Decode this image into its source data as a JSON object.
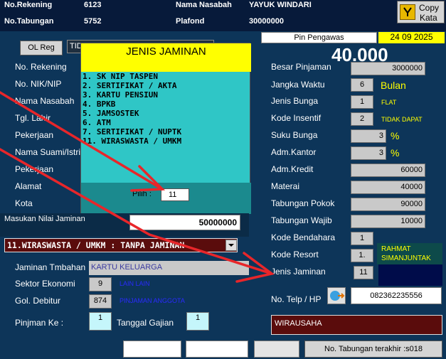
{
  "header": {
    "no_rekening_label": "No.Rekening",
    "no_rekening_value": "6123",
    "nama_nasabah_label": "Nama Nasabah",
    "nama_nasabah_value": "YAYUK WINDARI",
    "no_tabungan_label": "No.Tabungan",
    "no_tabungan_value": "5752",
    "plafond_label": "Plafond",
    "plafond_value": "30000000",
    "copy_kata_line1": "Copy",
    "copy_kata_line2": "Kata"
  },
  "pin_pengawas_label": "Pin Pengawas",
  "date": "24 09 2025",
  "big_amount": "40.000",
  "ol_reg_label": "OL Reg",
  "ol_reg_field": "TID",
  "left_labels": {
    "no_rekening": "No. Rekening",
    "no_nik": "No. NIK/NIP",
    "nama_nasabah": "Nama Nasabah",
    "tgl_lahir": "Tgl. Lahir",
    "pekerjaan": "Pekerjaan",
    "nama_suami": "Nama Suami/Istri",
    "pekerjaan2": "Pekerjaan",
    "alamat": "Alamat",
    "kota": "Kota"
  },
  "popup": {
    "title": "JENIS JAMINAN",
    "items": [
      "1. SK NIP TASPEN",
      "2. SERTIFIKAT / AKTA",
      "3. KARTU PENSIUN",
      "4. BPKB",
      "5. JAMSOSTEK",
      "6. ATM",
      "7. SERTIFIKAT / NUPTK",
      "11. WIRASWASTA / UMKM"
    ],
    "pilih_label": "Pilih :",
    "pilih_value": "11"
  },
  "masukan_label": "Masukan Nilai Jaminan",
  "masukan_value": "50000000",
  "jaminan_select": "11.WIRASWASTA / UMKM : TANPA JAMINAN",
  "jaminan_tambahan_label": "Jaminan Tmbahan",
  "jaminan_tambahan_value": "KARTU KELUARGA",
  "sektor_label": "Sektor Ekonomi",
  "sektor_code": "9",
  "sektor_text": "LAIN LAIN",
  "gol_label": "Gol. Debitur",
  "gol_code": "874",
  "gol_text": "PINJAMAN ANGGOTA",
  "pinjaman_ke_label": "Pinjman Ke :",
  "pinjaman_ke_value": "1",
  "tanggal_gajian_label": "Tanggal Gajian",
  "tanggal_gajian_value": "1",
  "right": {
    "besar_pinjaman_label": "Besar Pinjaman",
    "besar_pinjaman_value": "3000000",
    "jangka_waktu_label": "Jangka Waktu",
    "jangka_waktu_value": "6",
    "jangka_waktu_unit": "Bulan",
    "jenis_bunga_label": "Jenis Bunga",
    "jenis_bunga_value": "1",
    "jenis_bunga_text": "FLAT",
    "kode_insentif_label": "Kode Insentif",
    "kode_insentif_value": "2",
    "kode_insentif_text": "TIDAK DAPAT",
    "suku_bunga_label": "Suku Bunga",
    "suku_bunga_value": "3",
    "adm_kantor_label": "Adm.Kantor",
    "adm_kantor_value": "3",
    "percent": "%",
    "adm_kredit_label": "Adm.Kredit",
    "adm_kredit_value": "60000",
    "materai_label": "Materai",
    "materai_value": "40000",
    "tab_pokok_label": "Tabungan Pokok",
    "tab_pokok_value": "90000",
    "tab_wajib_label": "Tabungan Wajib",
    "tab_wajib_value": "10000",
    "kode_bendahara_label": "Kode Bendahara",
    "kode_bendahara_value": "1",
    "kode_resort_label": "Kode Resort",
    "kode_resort_value": "1.",
    "resort_name_line1": "RAHMAT",
    "resort_name_line2": "SIMANJUNTAK",
    "jenis_jaminan_label": "Jenis Jaminan",
    "jenis_jaminan_value": "11",
    "no_telp_label": "No. Telp / HP",
    "no_telp_value": "082362235556",
    "pekerjaan_value": "WIRAUSAHA"
  },
  "footer_button": "No. Tabungan terakhir :s018",
  "colors": {
    "background": "#0d3559",
    "popup": "#2fc6c6",
    "popup_title": "#ffff00",
    "annotation_arrow": "#e8262a"
  }
}
